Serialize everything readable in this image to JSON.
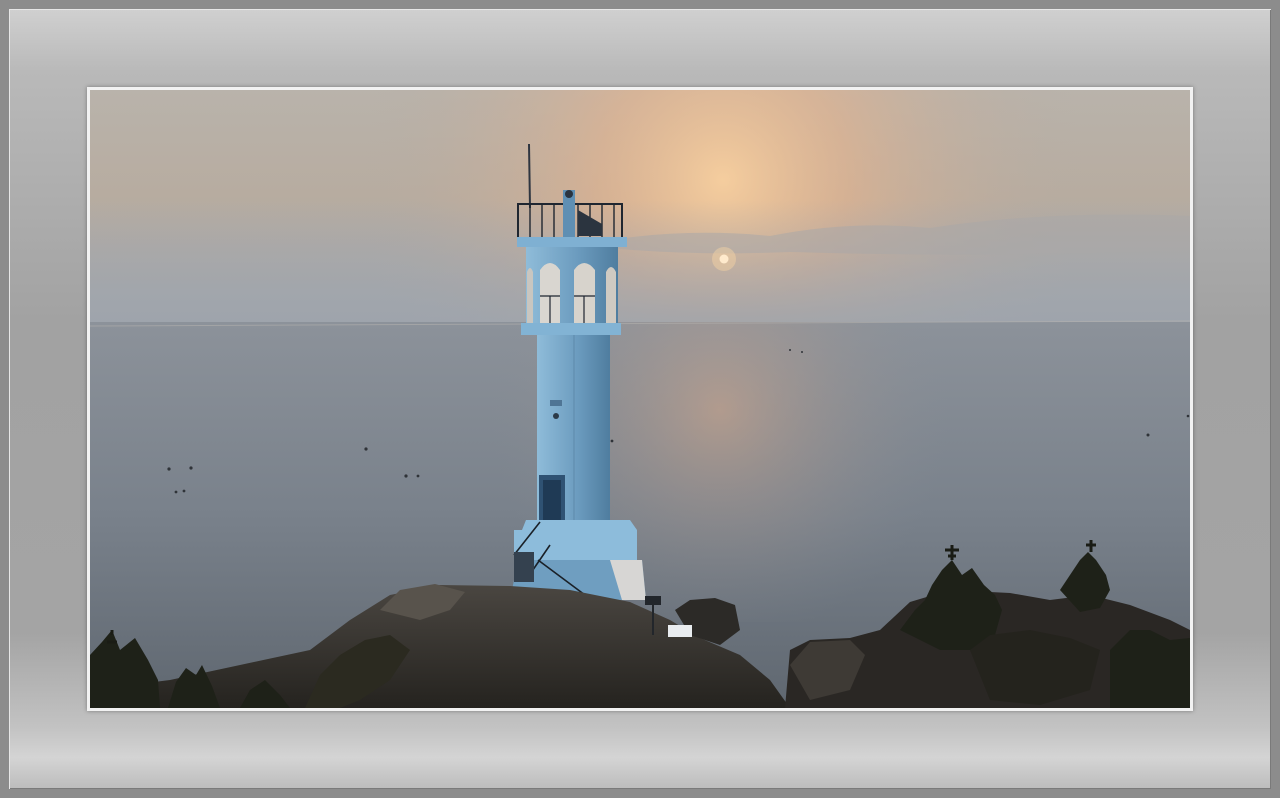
{
  "scene": {
    "subject": "lighthouse-at-sunset",
    "colors": {
      "sky_top": "#b9b3ab",
      "sun_glow": "#f3c79a",
      "haze": "#a7acb3",
      "sea": "#7f8791",
      "lighthouse": "#6f9ec0",
      "rock": "#3e3b37"
    }
  }
}
